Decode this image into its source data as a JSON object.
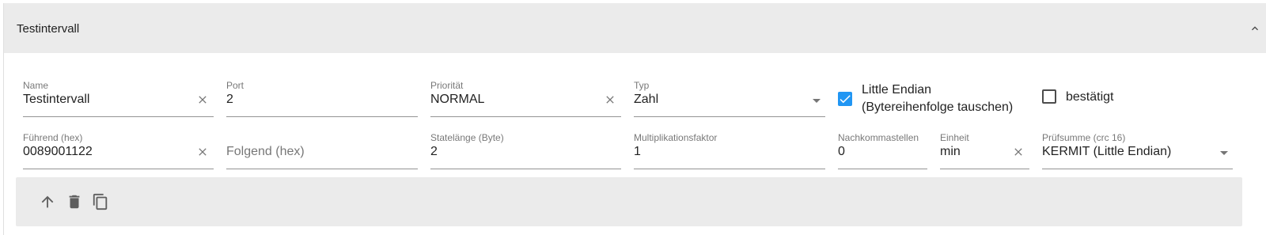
{
  "panel": {
    "title": "Testintervall",
    "collapse_icon": "chevron-up-icon"
  },
  "fields": {
    "name": {
      "label": "Name",
      "value": "Testintervall"
    },
    "port": {
      "label": "Port",
      "value": "2"
    },
    "prioritaet": {
      "label": "Priorität",
      "value": "NORMAL"
    },
    "typ": {
      "label": "Typ",
      "value": "Zahl"
    },
    "fuehrend": {
      "label": "Führend (hex)",
      "value": "0089001122"
    },
    "folgend": {
      "placeholder": "Folgend (hex)"
    },
    "statelaenge": {
      "label": "Statelänge (Byte)",
      "value": "2"
    },
    "multiplikationsfaktor": {
      "label": "Multiplikationsfaktor",
      "value": "1"
    },
    "nachkommastellen": {
      "label": "Nachkommastellen",
      "value": "0"
    },
    "einheit": {
      "label": "Einheit",
      "value": "min"
    },
    "pruefsumme": {
      "label": "Prüfsumme (crc 16)",
      "value": "KERMIT (Little Endian)"
    }
  },
  "checkboxes": {
    "little_endian": {
      "line1": "Little Endian",
      "line2": "(Bytereihenfolge tauschen)",
      "checked": true
    },
    "bestaetigt": {
      "label": "bestätigt",
      "checked": false
    }
  },
  "toolbar": {
    "icons": [
      "arrow-up-icon",
      "delete-icon",
      "copy-icon"
    ]
  },
  "colors": {
    "accent": "#2196f3",
    "header_bg": "#ebebeb",
    "toolbar_bg": "#ebebeb"
  }
}
